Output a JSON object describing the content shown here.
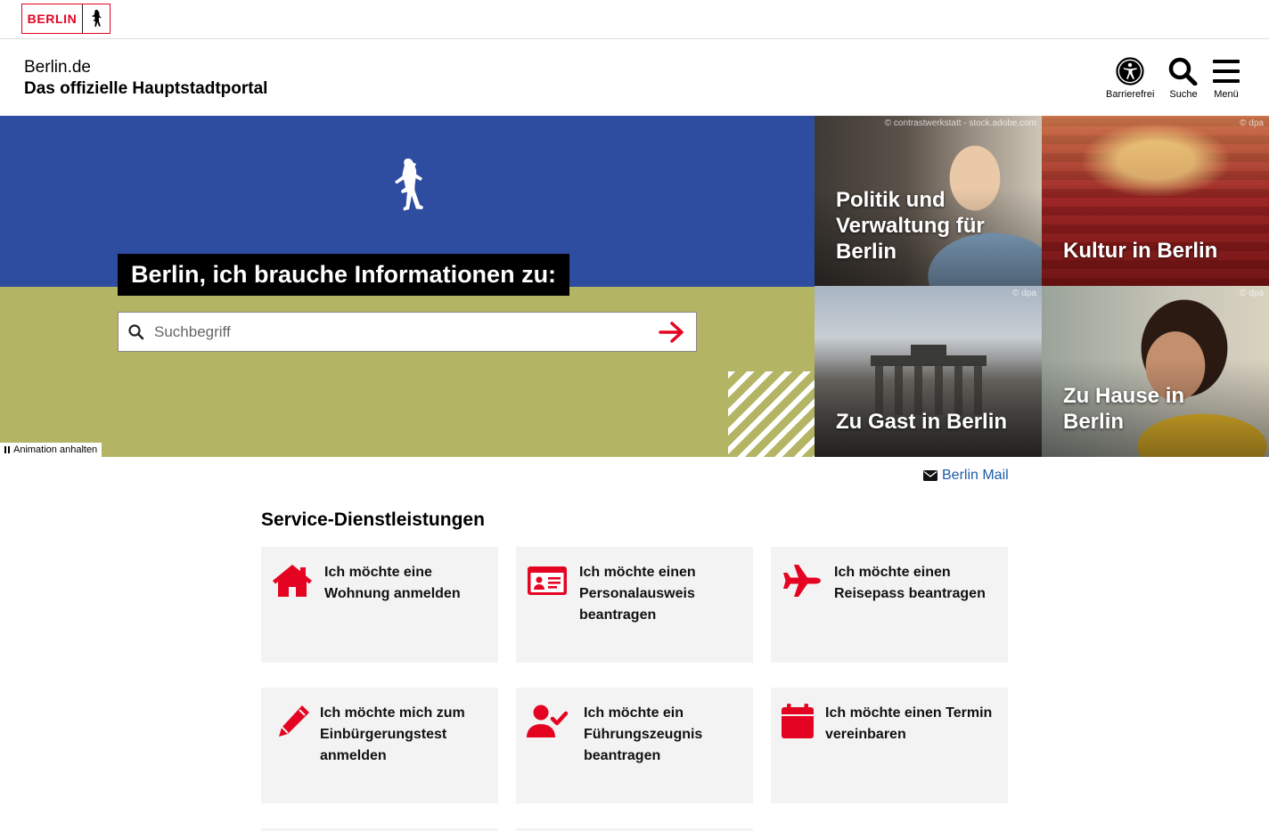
{
  "brand": {
    "logo_text": "BERLIN",
    "accent_color": "#e40422"
  },
  "header": {
    "site_name": "Berlin.de",
    "site_tagline": "Das offizielle Hauptstadtportal",
    "accessibility_label": "Barrierefrei",
    "search_label": "Suche",
    "menu_label": "Menü"
  },
  "hero": {
    "claim": "Berlin, ich brauche Informationen zu:",
    "search_placeholder": "Suchbegriff",
    "animation_toggle_label": "Animation anhalten",
    "colors": {
      "top": "#2f4da0",
      "bottom": "#b3b565"
    }
  },
  "tiles": [
    {
      "title": "Politik und Verwaltung für Berlin",
      "credit": "© contrastwerkstatt - stock.adobe.com"
    },
    {
      "title": "Kultur in Berlin",
      "credit": "© dpa"
    },
    {
      "title": "Zu Gast in Berlin",
      "credit": "© dpa"
    },
    {
      "title": "Zu Hause in Berlin",
      "credit": "© dpa"
    }
  ],
  "mail_link": "Berlin Mail",
  "services": {
    "heading": "Service-Dienstleistungen",
    "items": [
      {
        "label": "Ich möchte eine Wohnung anmelden",
        "icon": "house-icon"
      },
      {
        "label": "Ich möchte einen Personalausweis beantragen",
        "icon": "id-card-icon"
      },
      {
        "label": "Ich möchte einen Reisepass beantragen",
        "icon": "airplane-icon"
      },
      {
        "label": "Ich möchte mich zum Einbürgerungstest anmelden",
        "icon": "pencil-icon"
      },
      {
        "label": "Ich möchte ein Führungszeugnis beantragen",
        "icon": "user-check-icon"
      },
      {
        "label": "Ich möchte einen Termin vereinbaren",
        "icon": "calendar-icon"
      }
    ]
  }
}
